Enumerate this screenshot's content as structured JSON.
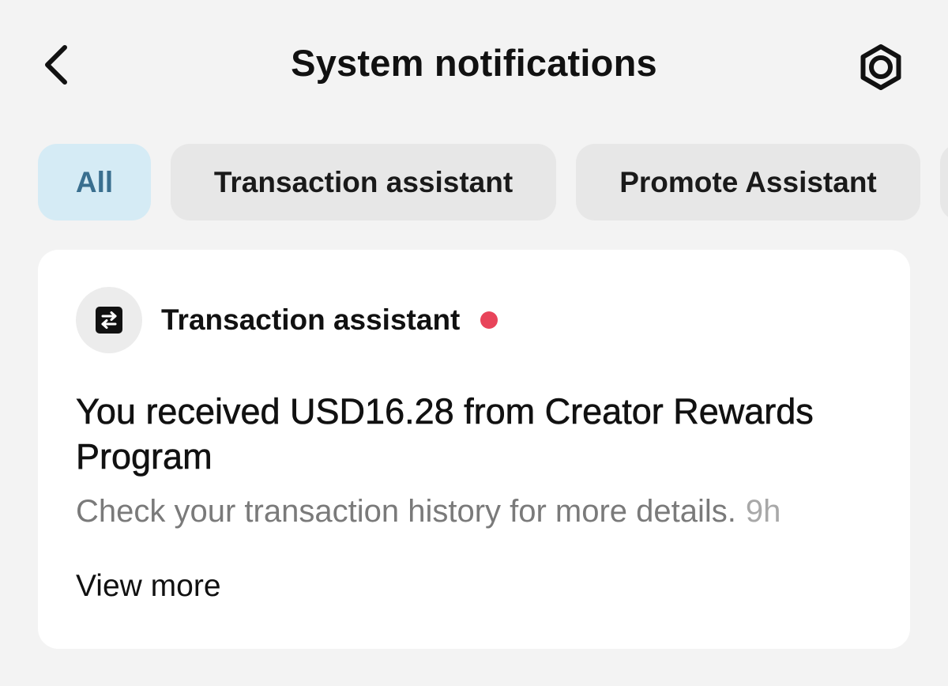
{
  "header": {
    "title": "System notifications",
    "back_icon": "chevron-left-icon",
    "settings_icon": "gear-icon"
  },
  "tabs": [
    {
      "label": "All",
      "active": true
    },
    {
      "label": "Transaction assistant",
      "active": false
    },
    {
      "label": "Promote Assistant",
      "active": false
    }
  ],
  "notification": {
    "sender": "Transaction assistant",
    "sender_icon": "transfer-icon",
    "unread": true,
    "title": "You received USD16.28 from Creator Rewards Program",
    "body": "Check your transaction history for more details.",
    "time": "9h",
    "view_more_label": "View more"
  },
  "colors": {
    "background": "#f3f3f3",
    "active_tab_bg": "#d5ebf5",
    "active_tab_text": "#3a6f8f",
    "inactive_tab_bg": "#e7e7e7",
    "unread_dot": "#e8445a",
    "card_bg": "#ffffff"
  }
}
